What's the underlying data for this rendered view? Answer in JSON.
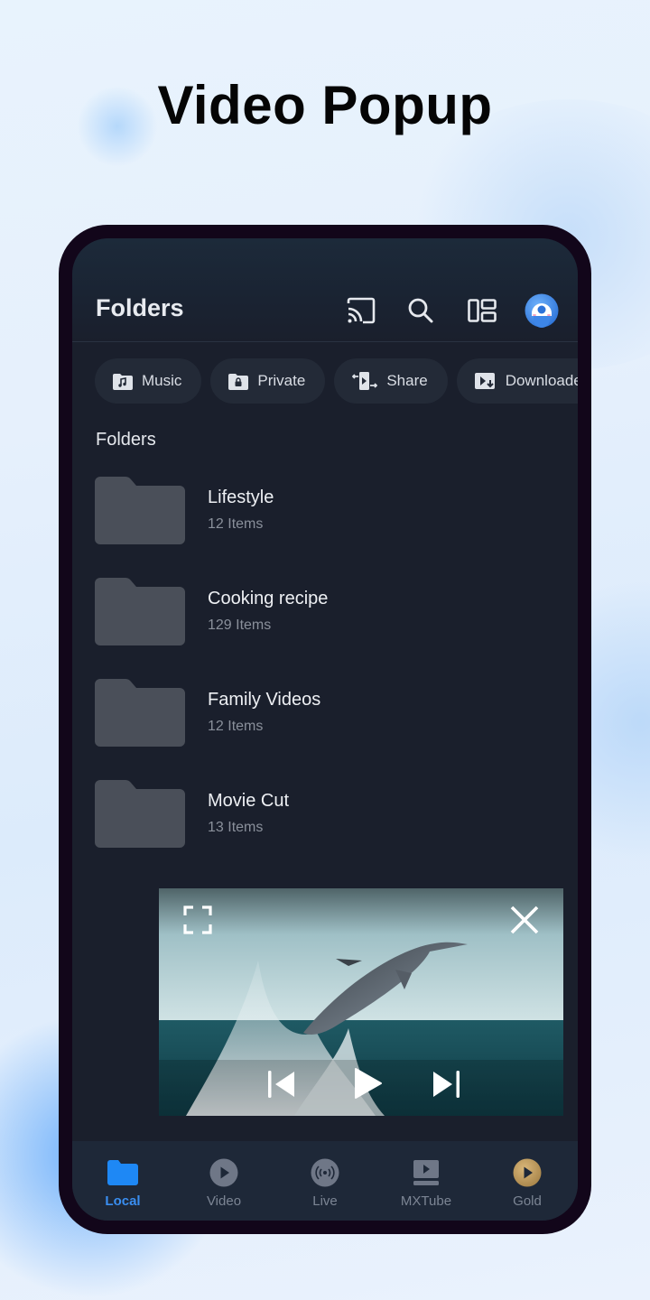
{
  "headline": "Video Popup",
  "appbar": {
    "title": "Folders",
    "icons": [
      "cast-icon",
      "search-icon",
      "layout-icon",
      "avatar"
    ]
  },
  "chips": [
    {
      "label": "Music",
      "icon": "music-folder-icon"
    },
    {
      "label": "Private",
      "icon": "lock-folder-icon"
    },
    {
      "label": "Share",
      "icon": "share-transfer-icon"
    },
    {
      "label": "Downloaded",
      "icon": "download-video-icon"
    }
  ],
  "section": {
    "label": "Folders"
  },
  "folders": [
    {
      "name": "Lifestyle",
      "count": "12 Items"
    },
    {
      "name": "Cooking recipe",
      "count": "129 Items"
    },
    {
      "name": "Family Videos",
      "count": "12 Items"
    },
    {
      "name": "Movie Cut",
      "count": "13 Items"
    }
  ],
  "popup": {
    "controls": [
      "fullscreen-icon",
      "close-icon",
      "previous-icon",
      "play-icon",
      "next-icon"
    ]
  },
  "bottom_nav": {
    "items": [
      {
        "label": "Local",
        "icon": "folder-icon",
        "active": true
      },
      {
        "label": "Video",
        "icon": "play-circle-icon",
        "active": false
      },
      {
        "label": "Live",
        "icon": "broadcast-icon",
        "active": false
      },
      {
        "label": "MXTube",
        "icon": "video-screen-icon",
        "active": false
      },
      {
        "label": "Gold",
        "icon": "gold-play-icon",
        "active": false
      }
    ]
  },
  "colors": {
    "accent": "#3a8ef0",
    "screen_bg": "#1a1f2c",
    "gold": "#b8965a"
  }
}
